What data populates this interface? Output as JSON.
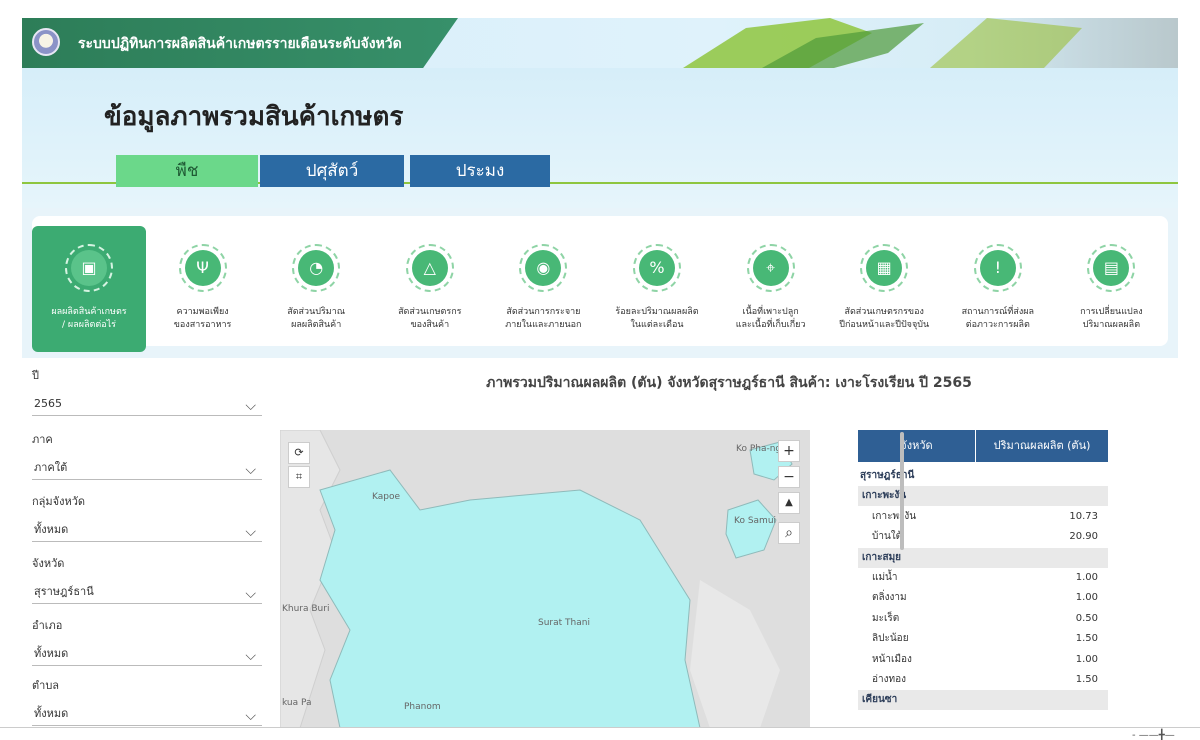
{
  "banner": {
    "system_title": "ระบบปฏิทินการผลิตสินค้าเกษตรรายเดือนระดับจังหวัด"
  },
  "page": {
    "title": "ข้อมูลภาพรวมสินค้าเกษตร"
  },
  "tabs": [
    {
      "label": "พืช",
      "active": true
    },
    {
      "label": "ปศุสัตว์",
      "active": false
    },
    {
      "label": "ประมง",
      "active": false
    }
  ],
  "menu": [
    {
      "line1": "ผลผลิตสินค้าเกษตร",
      "line2": "/ ผลผลิตต่อไร่",
      "icon": "box-icon",
      "active": true
    },
    {
      "line1": "ความพอเพียง",
      "line2": "ของสารอาหาร",
      "icon": "utensils-icon",
      "active": false
    },
    {
      "line1": "สัดส่วนปริมาณ",
      "line2": "ผลผลิตสินค้า",
      "icon": "pie-icon",
      "active": false
    },
    {
      "line1": "สัดส่วนเกษตรกร",
      "line2": "ของสินค้า",
      "icon": "farmer-icon",
      "active": false
    },
    {
      "line1": "สัดส่วนการกระจาย",
      "line2": "ภายในและภายนอก",
      "icon": "globe-pin-icon",
      "active": false
    },
    {
      "line1": "ร้อยละปริมาณผลผลิต",
      "line2": "ในแต่ละเดือน",
      "icon": "percent-icon",
      "active": false
    },
    {
      "line1": "เนื้อที่เพาะปลูก",
      "line2": "และเนื้อที่เก็บเกี่ยว",
      "icon": "map-pin-icon",
      "active": false
    },
    {
      "line1": "สัดส่วนเกษตรกรของ",
      "line2": "ปีก่อนหน้าและปีปัจจุบัน",
      "icon": "calendar-clock-icon",
      "active": false
    },
    {
      "line1": "สถานการณ์ที่ส่งผล",
      "line2": "ต่อภาวะการผลิต",
      "icon": "message-alert-icon",
      "active": false
    },
    {
      "line1": "การเปลี่ยนแปลง",
      "line2": "ปริมาณผลผลิต",
      "icon": "report-chart-icon",
      "active": false
    }
  ],
  "filters": [
    {
      "label": "ปี",
      "value": "2565"
    },
    {
      "label": "ภาค",
      "value": "ภาคใต้"
    },
    {
      "label": "กลุ่มจังหวัด",
      "value": "ทั้งหมด"
    },
    {
      "label": "จังหวัด",
      "value": "สุราษฎร์ธานี"
    },
    {
      "label": "อำเภอ",
      "value": "ทั้งหมด"
    },
    {
      "label": "ตำบล",
      "value": "ทั้งหมด"
    }
  ],
  "panel": {
    "title": "ภาพรวมปริมาณผลผลิต (ตัน) จังหวัดสุราษฎร์ธานี สินค้า: เงาะโรงเรียน ปี 2565"
  },
  "map": {
    "labels": [
      "Ko Pha-ngan",
      "Kapoe",
      "Ko Samui",
      "Khura Buri",
      "Surat Thani",
      "kua Pa",
      "Phanom"
    ],
    "controls": {
      "zoom_in": "+",
      "zoom_out": "−",
      "compass": "▲",
      "search": "⌕"
    },
    "fill_color": "#b1f1f1"
  },
  "table": {
    "headers": [
      "จังหวัด",
      "ปริมาณผลผลิต (ตัน)"
    ],
    "rows": [
      {
        "level": "province",
        "name": "สุราษฎร์ธานี",
        "value": ""
      },
      {
        "level": "district",
        "name": "เกาะพะงัน",
        "value": ""
      },
      {
        "level": "subdistrict",
        "name": "เกาะพะงัน",
        "value": "10.73"
      },
      {
        "level": "subdistrict",
        "name": "บ้านใต้",
        "value": "20.90"
      },
      {
        "level": "district",
        "name": "เกาะสมุย",
        "value": ""
      },
      {
        "level": "subdistrict",
        "name": "แม่น้ำ",
        "value": "1.00"
      },
      {
        "level": "subdistrict",
        "name": "ตลิ่งงาม",
        "value": "1.00"
      },
      {
        "level": "subdistrict",
        "name": "มะเร็ต",
        "value": "0.50"
      },
      {
        "level": "subdistrict",
        "name": "ลิปะน้อย",
        "value": "1.50"
      },
      {
        "level": "subdistrict",
        "name": "หน้าเมือง",
        "value": "1.00"
      },
      {
        "level": "subdistrict",
        "name": "อ่างทอง",
        "value": "1.50"
      },
      {
        "level": "district",
        "name": "เคียนซา",
        "value": ""
      }
    ]
  }
}
